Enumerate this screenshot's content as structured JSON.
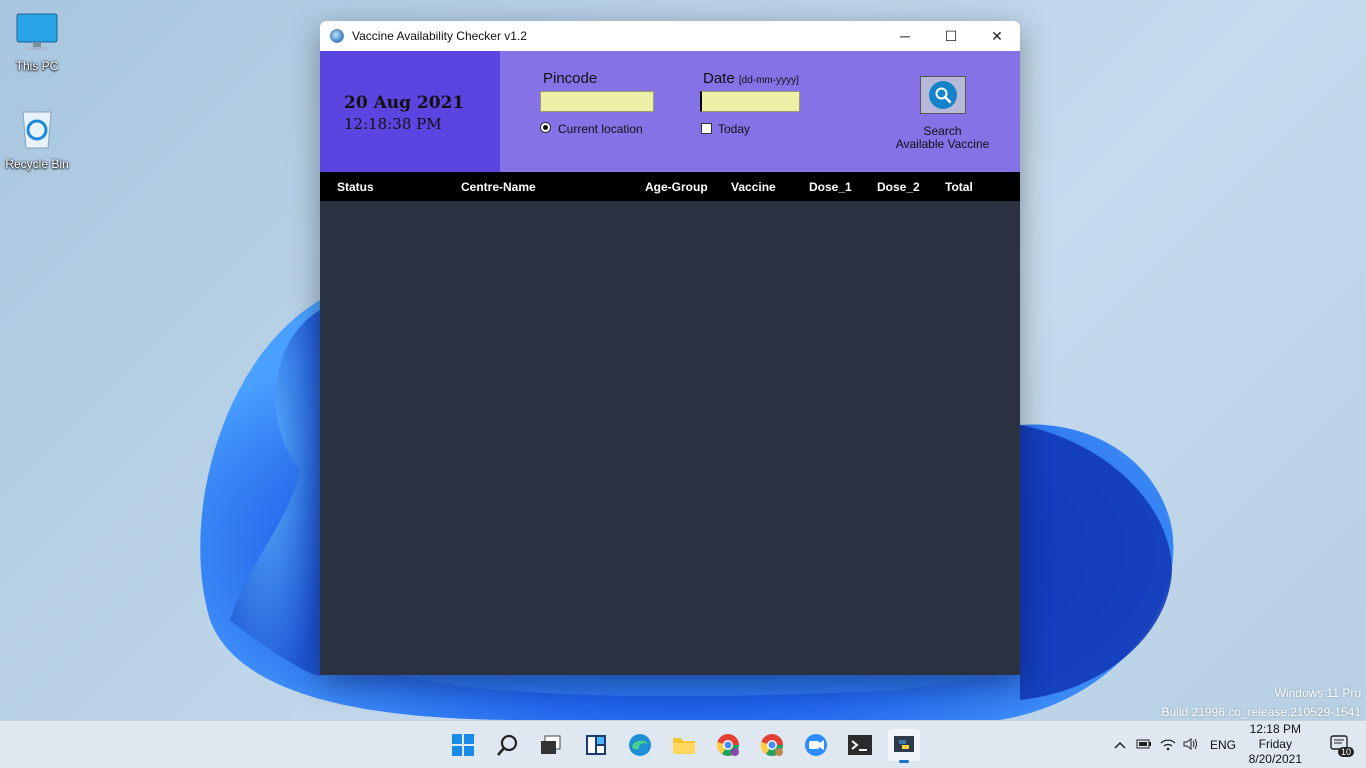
{
  "desktop": {
    "icons": [
      {
        "label": "This PC"
      },
      {
        "label": "Recycle Bin"
      }
    ]
  },
  "window": {
    "title": "Vaccine Availability Checker  v1.2",
    "controls": {
      "minimize": "─",
      "maximize": "☐",
      "close": "✕"
    }
  },
  "clock_panel": {
    "date": "20 Aug 2021",
    "time": "12:18:38 PM"
  },
  "form": {
    "pincode_label": "Pincode",
    "pincode_value": "",
    "date_label": "Date",
    "date_hint": "[dd-mm-yyyy]",
    "date_value": "",
    "current_location_label": "Current location",
    "current_location_selected": true,
    "today_label": "Today",
    "today_checked": false,
    "search_caption_1": "Search",
    "search_caption_2": "Available Vaccine"
  },
  "table": {
    "columns": [
      "Status",
      "Centre-Name",
      "Age-Group",
      "Vaccine",
      "Dose_1",
      "Dose_2",
      "Total"
    ],
    "rows": []
  },
  "watermark": {
    "line1": "Windows 11 Pro",
    "line2": "Build 21996.co_release.210529-1541"
  },
  "taskbar": {
    "apps": [
      "start-icon",
      "search-icon",
      "task-view-icon",
      "widgets-icon",
      "edge-icon",
      "file-explorer-icon",
      "chrome-icon",
      "chrome-profile-icon",
      "zoom-icon",
      "terminal-icon",
      "python-icon"
    ],
    "language": "ENG",
    "clock_time": "12:18 PM",
    "clock_day": "Friday",
    "clock_date": "8/20/2021",
    "notification_count": "10"
  },
  "colors": {
    "clock_panel": "#5a45e0",
    "form_band": "#8472e6",
    "input_bg": "#eef0a8",
    "table_header": "#000000",
    "table_body": "#2a3140"
  }
}
